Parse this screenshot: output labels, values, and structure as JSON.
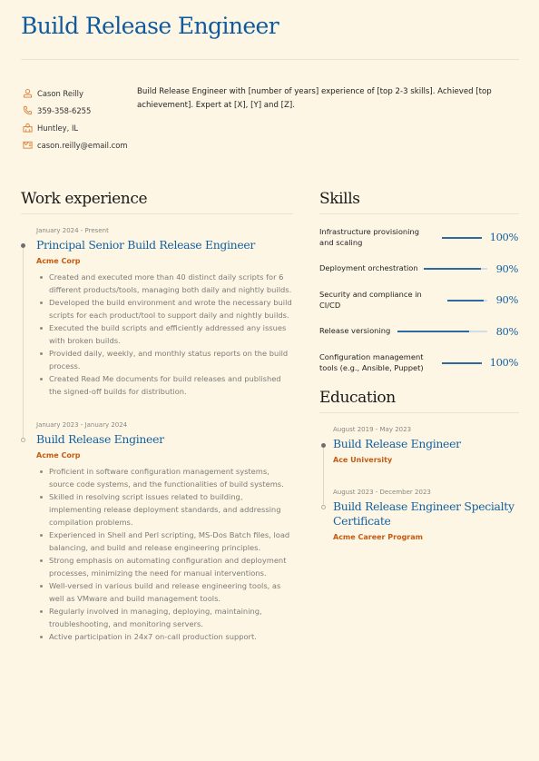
{
  "header": {
    "title": "Build Release Engineer"
  },
  "contact": [
    {
      "icon": "person-icon",
      "text": "Cason Reilly"
    },
    {
      "icon": "phone-icon",
      "text": "359-358-6255"
    },
    {
      "icon": "location-icon",
      "text": "Huntley, IL"
    },
    {
      "icon": "email-icon",
      "text": "cason.reilly@email.com"
    }
  ],
  "summary": "Build Release Engineer with [number of years] experience of [top 2-3 skills]. Achieved [top achievement]. Expert at [X], [Y] and [Z].",
  "colors": {
    "accent": "#14619f",
    "company": "#c55a11",
    "background": "#fdf6e5",
    "icon": "#d9803a"
  },
  "work": {
    "title": "Work experience",
    "entries": [
      {
        "date": "January 2024 - Present",
        "title": "Principal Senior Build Release Engineer",
        "company": "Acme Corp",
        "bullets": [
          "Created and executed more than 40 distinct daily scripts for 6 different products/tools, managing both daily and nightly builds.",
          "Developed the build environment and wrote the necessary build scripts for each product/tool to support daily and nightly builds.",
          "Executed the build scripts and efficiently addressed any issues with broken builds.",
          "Provided daily, weekly, and monthly status reports on the build process.",
          "Created Read Me documents for build releases and published the signed-off builds for distribution."
        ]
      },
      {
        "date": "January 2023 - January 2024",
        "title": "Build Release Engineer",
        "company": "Acme Corp",
        "bullets": [
          "Proficient in software configuration management systems, source code systems, and the functionalities of build systems.",
          "Skilled in resolving script issues related to building, implementing release deployment standards, and addressing compilation problems.",
          "Experienced in Shell and Perl scripting, MS-Dos Batch files, load balancing, and build and release engineering principles.",
          "Strong emphasis on automating configuration and deployment processes, minimizing the need for manual interventions.",
          "Well-versed in various build and release engineering tools, as well as VMware and build management tools.",
          "Regularly involved in managing, deploying, maintaining, troubleshooting, and monitoring servers.",
          "Active participation in 24x7 on-call production support."
        ]
      }
    ]
  },
  "skills": {
    "title": "Skills",
    "items": [
      {
        "name": "Infrastructure provisioning and scaling",
        "level": 100,
        "label": "100%"
      },
      {
        "name": "Deployment orchestration",
        "level": 90,
        "label": "90%"
      },
      {
        "name": "Security and compliance in CI/CD",
        "level": 90,
        "label": "90%"
      },
      {
        "name": "Release versioning",
        "level": 80,
        "label": "80%"
      },
      {
        "name": "Configuration management tools (e.g., Ansible, Puppet)",
        "level": 100,
        "label": "100%"
      }
    ]
  },
  "education": {
    "title": "Education",
    "entries": [
      {
        "date": "August 2019 - May 2023",
        "title": "Build Release Engineer",
        "school": "Ace University"
      },
      {
        "date": "August 2023 - December 2023",
        "title": "Build Release Engineer Specialty Certificate",
        "school": "Acme Career Program"
      }
    ]
  }
}
